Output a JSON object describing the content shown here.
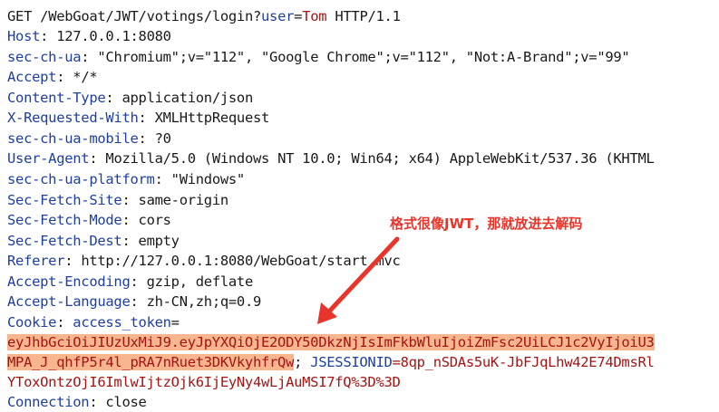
{
  "request": {
    "method": "GET",
    "path": "/WebGoat/JWT/votings/login?",
    "param_name": "user",
    "param_eq": "=",
    "param_value": "Tom",
    "protocol": " HTTP/1.1"
  },
  "headers": [
    {
      "name": "Host",
      "value": "127.0.0.1:8080"
    },
    {
      "name": "sec-ch-ua",
      "value": "\"Chromium\";v=\"112\", \"Google Chrome\";v=\"112\", \"Not:A-Brand\";v=\"99\""
    },
    {
      "name": "Accept",
      "value": "*/*"
    },
    {
      "name": "Content-Type",
      "value": "application/json"
    },
    {
      "name": "X-Requested-With",
      "value": "XMLHttpRequest"
    },
    {
      "name": "sec-ch-ua-mobile",
      "value": "?0"
    },
    {
      "name": "User-Agent",
      "value": "Mozilla/5.0 (Windows NT 10.0; Win64; x64) AppleWebKit/537.36 (KHTML"
    },
    {
      "name": "sec-ch-ua-platform",
      "value": "\"Windows\""
    },
    {
      "name": "Sec-Fetch-Site",
      "value": "same-origin"
    },
    {
      "name": "Sec-Fetch-Mode",
      "value": "cors"
    },
    {
      "name": "Sec-Fetch-Dest",
      "value": "empty"
    },
    {
      "name": "Referer",
      "value": "http://127.0.0.1:8080/WebGoat/start.mvc"
    },
    {
      "name": "Accept-Encoding",
      "value": "gzip, deflate"
    },
    {
      "name": "Accept-Language",
      "value": "zh-CN,zh;q=0.9"
    }
  ],
  "cookie": {
    "header_name": "Cookie",
    "token_name": "access_token",
    "token_eq": "=",
    "token_line1": "eyJhbGciOiJIUzUxMiJ9.eyJpYXQiOjE2ODY50DkzNjIsImFkbWluIjoiZmFsc2UiLCJ1c2VyIjoiU3",
    "token_line2": "MPA_J_qhfP5r4l_pRA7nRuet3DKVkyhfrQw",
    "separator": "; ",
    "session_name": "JSESSIONID",
    "session_value": "=8qp_nSDAs5uK-JbFJqLhw42E74DmsRl",
    "line3": "YToxOntzOjI6ImlwIjtzOjk6IjEyNy4wLjAuMSI7fQ%3D%3D"
  },
  "last_header": {
    "name": "Connection",
    "value": "close"
  },
  "annotation_text": "格式很像JWT，那就放进去解码",
  "colors": {
    "key": "#1f3f9e",
    "value": "#a31515",
    "highlight": "#f7b68e",
    "annotation": "#e8342a"
  }
}
